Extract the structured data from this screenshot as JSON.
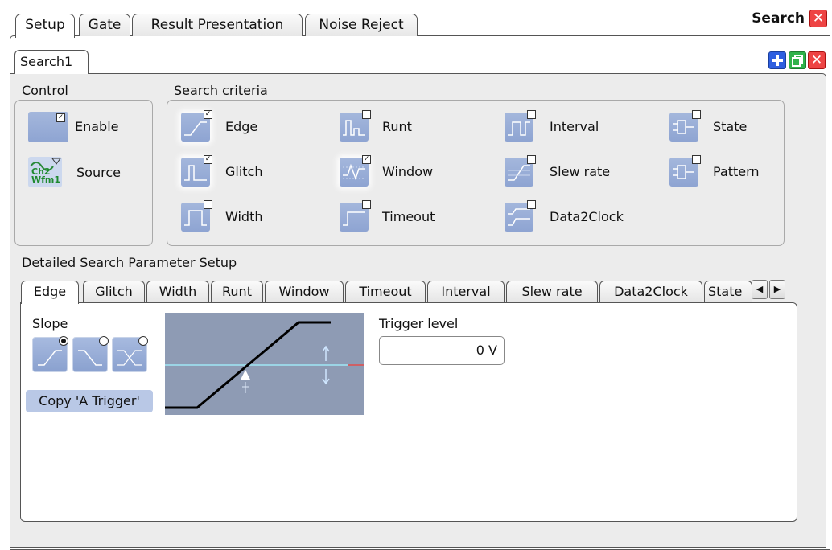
{
  "window": {
    "title": "Search"
  },
  "top_tabs": [
    "Setup",
    "Gate",
    "Result Presentation",
    "Noise Reject"
  ],
  "search_tab": "Search1",
  "control": {
    "title": "Control",
    "enable_label": "Enable",
    "source_label": "Source",
    "source_icon_text": [
      "Ch2",
      "Wfm1"
    ]
  },
  "criteria": {
    "title": "Search criteria",
    "items": [
      {
        "label": "Edge",
        "checked": true
      },
      {
        "label": "Runt",
        "checked": false
      },
      {
        "label": "Interval",
        "checked": false
      },
      {
        "label": "State",
        "checked": false
      },
      {
        "label": "Glitch",
        "checked": true
      },
      {
        "label": "Window",
        "checked": true
      },
      {
        "label": "Slew rate",
        "checked": false
      },
      {
        "label": "Pattern",
        "checked": false
      },
      {
        "label": "Width",
        "checked": false
      },
      {
        "label": "Timeout",
        "checked": false
      },
      {
        "label": "Data2Clock",
        "checked": false
      }
    ]
  },
  "detail": {
    "title": "Detailed Search Parameter Setup",
    "tabs": [
      "Edge",
      "Glitch",
      "Width",
      "Runt",
      "Window",
      "Timeout",
      "Interval",
      "Slew rate",
      "Data2Clock",
      "State"
    ],
    "slope_label": "Slope",
    "slope_selected": "rising",
    "copy_button": "Copy 'A Trigger'",
    "trigger_level_label": "Trigger level",
    "trigger_level_value": "0 V"
  },
  "colors": {
    "icon_bg": "#9aafda",
    "preview_bg": "#8e9bb4",
    "level_line": "#9fe7f5",
    "close_red": "#e44444",
    "add_blue": "#2e5fe0",
    "copy_green": "#2fb24a"
  }
}
